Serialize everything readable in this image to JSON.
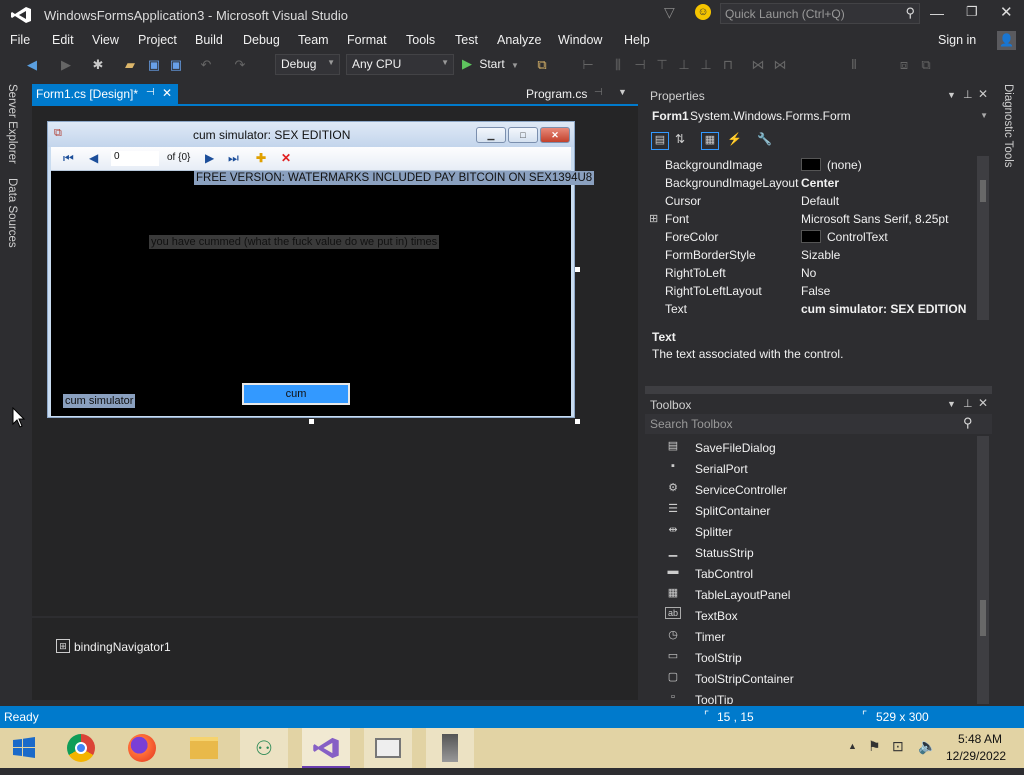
{
  "window": {
    "title": "WindowsFormsApplication3 - Microsoft Visual Studio",
    "quick_launch": "Quick Launch (Ctrl+Q)",
    "sign_in": "Sign in"
  },
  "menu": [
    "File",
    "Edit",
    "View",
    "Project",
    "Build",
    "Debug",
    "Team",
    "Format",
    "Tools",
    "Test",
    "Analyze",
    "Window",
    "Help"
  ],
  "toolbar": {
    "config": "Debug",
    "platform": "Any CPU",
    "start": "Start"
  },
  "left_rail": [
    "Server Explorer",
    "Data Sources"
  ],
  "right_rail": "Diagnostic Tools",
  "doc_tabs": {
    "active": "Form1.cs [Design]*",
    "other": "Program.cs"
  },
  "form": {
    "title": "cum simulator: SEX EDITION",
    "nav_position": "0",
    "nav_count": "of {0}",
    "watermark": "FREE VERSION: WATERMARKS INCLUDED PAY BITCOIN ON SEX1394U8",
    "label_count": "you have cummed (what the fuck value do we put in) times",
    "label_app": "cum simulator",
    "button": "cum"
  },
  "tray": {
    "component": "bindingNavigator1"
  },
  "properties": {
    "header": "Properties",
    "object": "Form1",
    "object_type": "System.Windows.Forms.Form",
    "rows": [
      {
        "name": "BackgroundImage",
        "value": "(none)",
        "swatch": "#000000"
      },
      {
        "name": "BackgroundImageLayout",
        "value": "Center",
        "bold": true
      },
      {
        "name": "Cursor",
        "value": "Default"
      },
      {
        "name": "Font",
        "value": "Microsoft Sans Serif, 8.25pt",
        "expand": true
      },
      {
        "name": "ForeColor",
        "value": "ControlText",
        "swatch": "#000000"
      },
      {
        "name": "FormBorderStyle",
        "value": "Sizable"
      },
      {
        "name": "RightToLeft",
        "value": "No"
      },
      {
        "name": "RightToLeftLayout",
        "value": "False"
      },
      {
        "name": "Text",
        "value": "cum simulator: SEX EDITION",
        "bold": true
      }
    ],
    "desc_title": "Text",
    "desc_text": "The text associated with the control."
  },
  "toolbox": {
    "header": "Toolbox",
    "search_placeholder": "Search Toolbox",
    "items": [
      {
        "label": "SaveFileDialog",
        "icon": "save-dialog-icon",
        "glyph": "▤"
      },
      {
        "label": "SerialPort",
        "icon": "serial-port-icon",
        "glyph": "▪"
      },
      {
        "label": "ServiceController",
        "icon": "gear-icon",
        "glyph": "⚙"
      },
      {
        "label": "SplitContainer",
        "icon": "split-container-icon",
        "glyph": "☰"
      },
      {
        "label": "Splitter",
        "icon": "splitter-icon",
        "glyph": "⇹"
      },
      {
        "label": "StatusStrip",
        "icon": "status-strip-icon",
        "glyph": "▁"
      },
      {
        "label": "TabControl",
        "icon": "tab-control-icon",
        "glyph": "▬"
      },
      {
        "label": "TableLayoutPanel",
        "icon": "table-layout-icon",
        "glyph": "▦"
      },
      {
        "label": "TextBox",
        "icon": "textbox-icon",
        "glyph": "ab"
      },
      {
        "label": "Timer",
        "icon": "timer-icon",
        "glyph": "◷"
      },
      {
        "label": "ToolStrip",
        "icon": "toolstrip-icon",
        "glyph": "▭"
      },
      {
        "label": "ToolStripContainer",
        "icon": "toolstrip-container-icon",
        "glyph": "▢"
      },
      {
        "label": "ToolTip",
        "icon": "tooltip-icon",
        "glyph": "▫"
      }
    ]
  },
  "status": {
    "text": "Ready",
    "position": "15 , 15",
    "size": "529 x 300"
  },
  "taskbar": {
    "time": "5:48 AM",
    "date": "12/29/2022"
  },
  "colors": {
    "accent": "#007acc",
    "ide_bg": "#2d2d30",
    "form_back": "#000000",
    "button_back": "#3399ff"
  }
}
